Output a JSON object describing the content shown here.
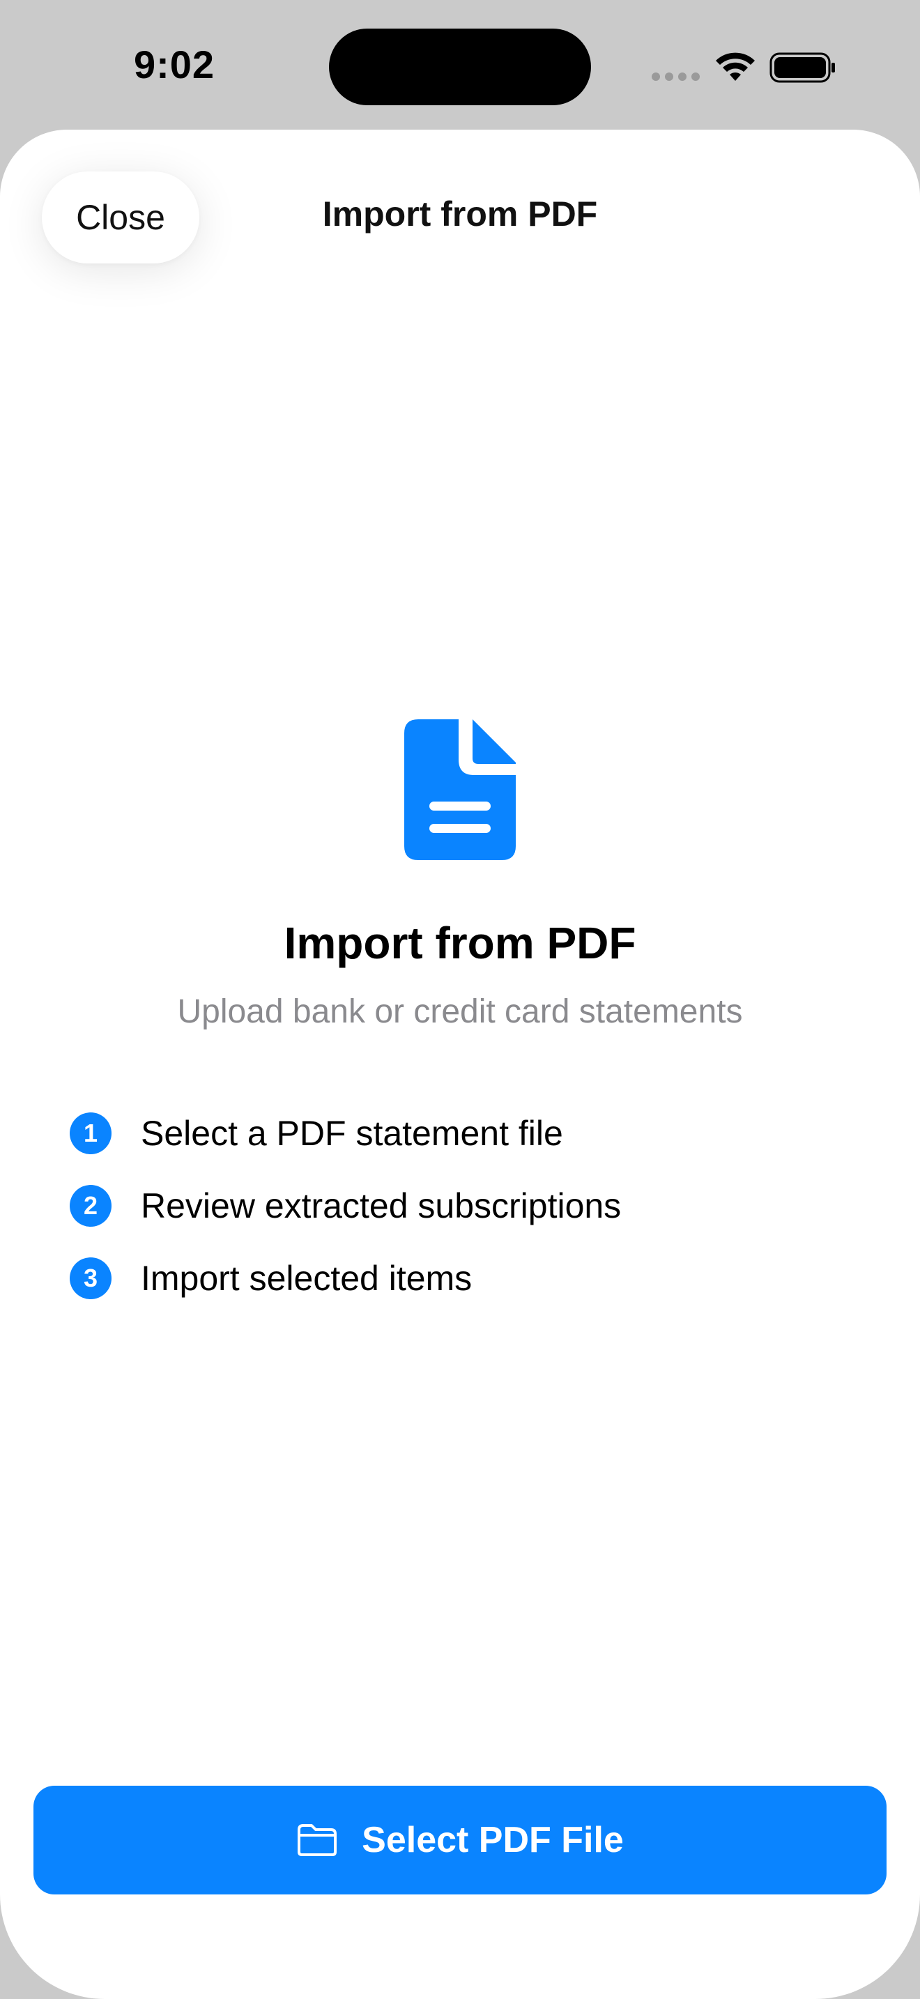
{
  "status_bar": {
    "time": "9:02",
    "wifi_icon": "wifi-icon",
    "battery_icon": "battery-icon"
  },
  "nav": {
    "close_label": "Close",
    "title": "Import from PDF"
  },
  "hero": {
    "icon": "document-icon",
    "title": "Import from PDF",
    "subtitle": "Upload bank or credit card statements"
  },
  "steps": [
    {
      "number": "1",
      "text": "Select a PDF statement file"
    },
    {
      "number": "2",
      "text": "Review extracted subscriptions"
    },
    {
      "number": "3",
      "text": "Import selected items"
    }
  ],
  "primary_action": {
    "icon": "folder-icon",
    "label": "Select PDF File"
  },
  "colors": {
    "accent": "#0a84ff",
    "secondary_text": "#8a8a8e",
    "background": "#ffffff"
  }
}
